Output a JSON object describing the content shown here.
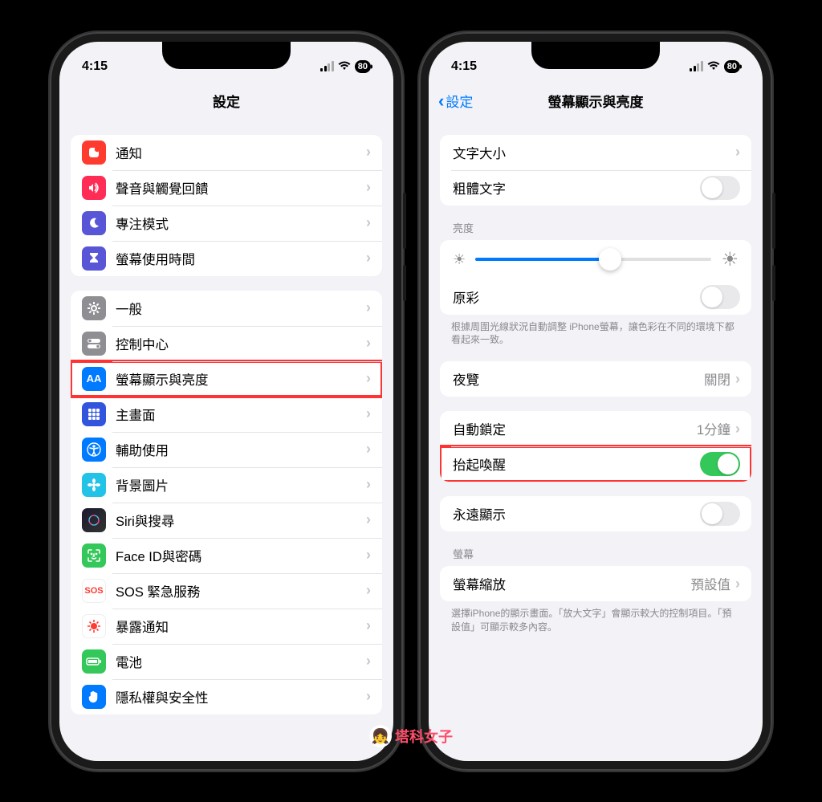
{
  "status": {
    "time": "4:15",
    "battery": "80"
  },
  "left": {
    "title": "設定",
    "groups": [
      {
        "rows": [
          {
            "key": "notifications",
            "icon": "bell",
            "bg": "#ff3b30",
            "label": "通知"
          },
          {
            "key": "sound",
            "icon": "speaker",
            "bg": "#ff2d55",
            "label": "聲音與觸覺回饋"
          },
          {
            "key": "focus",
            "icon": "moon",
            "bg": "#5856d6",
            "label": "專注模式"
          },
          {
            "key": "screentime",
            "icon": "hourglass",
            "bg": "#5856d6",
            "label": "螢幕使用時間"
          }
        ]
      },
      {
        "rows": [
          {
            "key": "general",
            "icon": "gear",
            "bg": "#8e8e93",
            "label": "一般"
          },
          {
            "key": "control",
            "icon": "switches",
            "bg": "#8e8e93",
            "label": "控制中心"
          },
          {
            "key": "display",
            "icon": "aa",
            "bg": "#007aff",
            "label": "螢幕顯示與亮度",
            "highlight": true
          },
          {
            "key": "home",
            "icon": "grid",
            "bg": "#3355dd",
            "label": "主畫面"
          },
          {
            "key": "accessibility",
            "icon": "person",
            "bg": "#007aff",
            "label": "輔助使用"
          },
          {
            "key": "wallpaper",
            "icon": "flower",
            "bg": "#22c3e6",
            "label": "背景圖片"
          },
          {
            "key": "siri",
            "icon": "siri",
            "bg": "#222",
            "label": "Siri與搜尋"
          },
          {
            "key": "faceid",
            "icon": "face",
            "bg": "#34c759",
            "label": "Face ID與密碼"
          },
          {
            "key": "sos",
            "icon": "sos",
            "bg": "#ff3b30",
            "label": "SOS 緊急服務"
          },
          {
            "key": "exposure",
            "icon": "virus",
            "bg": "#fff",
            "fg": "#ff3b30",
            "label": "暴露通知"
          },
          {
            "key": "battery",
            "icon": "batt",
            "bg": "#34c759",
            "label": "電池"
          },
          {
            "key": "privacy",
            "icon": "hand",
            "bg": "#007aff",
            "label": "隱私權與安全性"
          }
        ]
      }
    ]
  },
  "right": {
    "back": "設定",
    "title": "螢幕顯示與亮度",
    "textsize": "文字大小",
    "boldtext": "粗體文字",
    "brightness_header": "亮度",
    "truetone": "原彩",
    "truetone_footer": "根據周圍光線狀況自動調整 iPhone螢幕，讓色彩在不同的環境下都看起來一致。",
    "nightshift": "夜覽",
    "nightshift_value": "關閉",
    "autolock": "自動鎖定",
    "autolock_value": "1分鐘",
    "raise": "抬起喚醒",
    "alwayson": "永遠顯示",
    "display_header": "螢幕",
    "zoom": "螢幕縮放",
    "zoom_value": "預設值",
    "zoom_footer": "選擇iPhone的顯示畫面。「放大文字」會顯示較大的控制項目。「預設值」可顯示較多內容。"
  },
  "watermark": "塔科女子"
}
